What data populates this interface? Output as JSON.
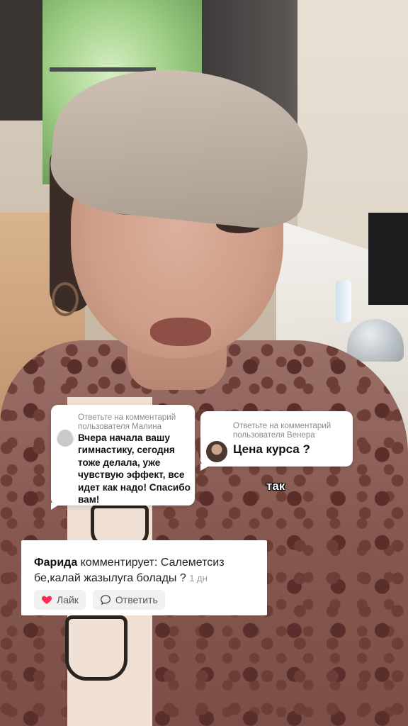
{
  "video": {
    "description_icon": "selfie-video-frame"
  },
  "reply_sticker_1": {
    "caption": "Ответьте на комментарий пользователя Малина",
    "text": "Вчера начала вашу гимнастику, сегодня тоже делала, уже чувствую эффект, все идет как надо! Спасибо вам!",
    "avatar_icon": "default-avatar-icon"
  },
  "reply_sticker_2": {
    "caption": "Ответьте на комментарий пользователя Венера",
    "text": "Цена курса ?",
    "avatar_icon": "user-avatar-photo"
  },
  "overlay_text": "так",
  "comment": {
    "author": "Фарида",
    "verb": "комментирует:",
    "text": "Салеметсиз бе,калай жазылуга болады ?",
    "time": "1 дн",
    "like_label": "Лайк",
    "reply_label": "Ответить",
    "like_icon": "heart-icon",
    "reply_icon": "comment-bubble-icon",
    "colors": {
      "heart": "#fe2c55",
      "card_bg": "#ffffff",
      "chip_bg": "#f1f1f2"
    }
  }
}
